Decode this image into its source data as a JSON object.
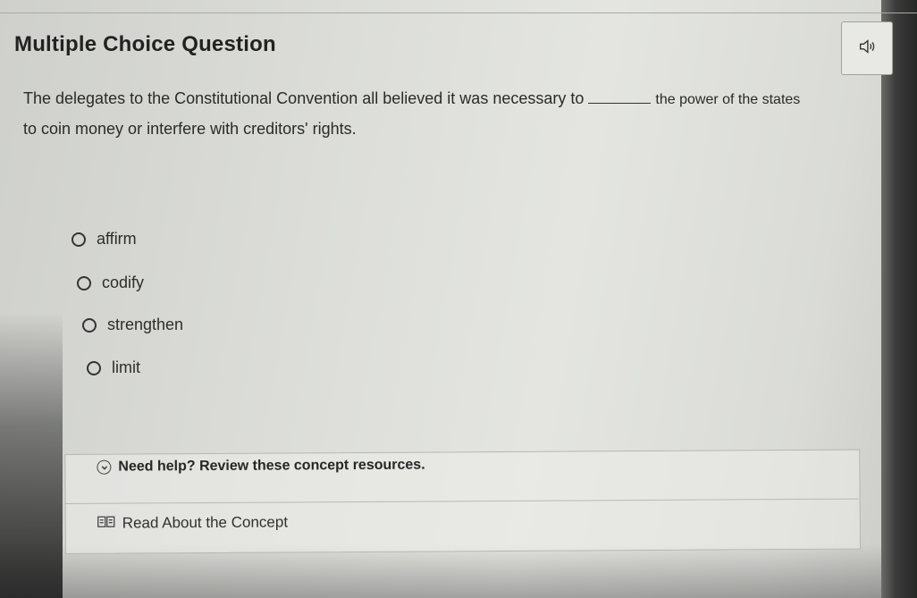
{
  "question": {
    "type_label": "Multiple Choice Question",
    "text_before_blank": "The delegates to the Constitutional Convention all believed it was necessary to",
    "text_after_blank": "the power of the states",
    "text_line2": "to coin money or interfere with creditors' rights.",
    "audio_icon": "speaker-icon"
  },
  "options": [
    {
      "label": "affirm"
    },
    {
      "label": "codify"
    },
    {
      "label": "strengthen"
    },
    {
      "label": "limit"
    }
  ],
  "help": {
    "header": "Need help? Review these concept resources.",
    "header_icon": "chevron-down-icon",
    "resources": [
      {
        "label": "Read About the Concept",
        "icon": "book-icon"
      }
    ]
  }
}
